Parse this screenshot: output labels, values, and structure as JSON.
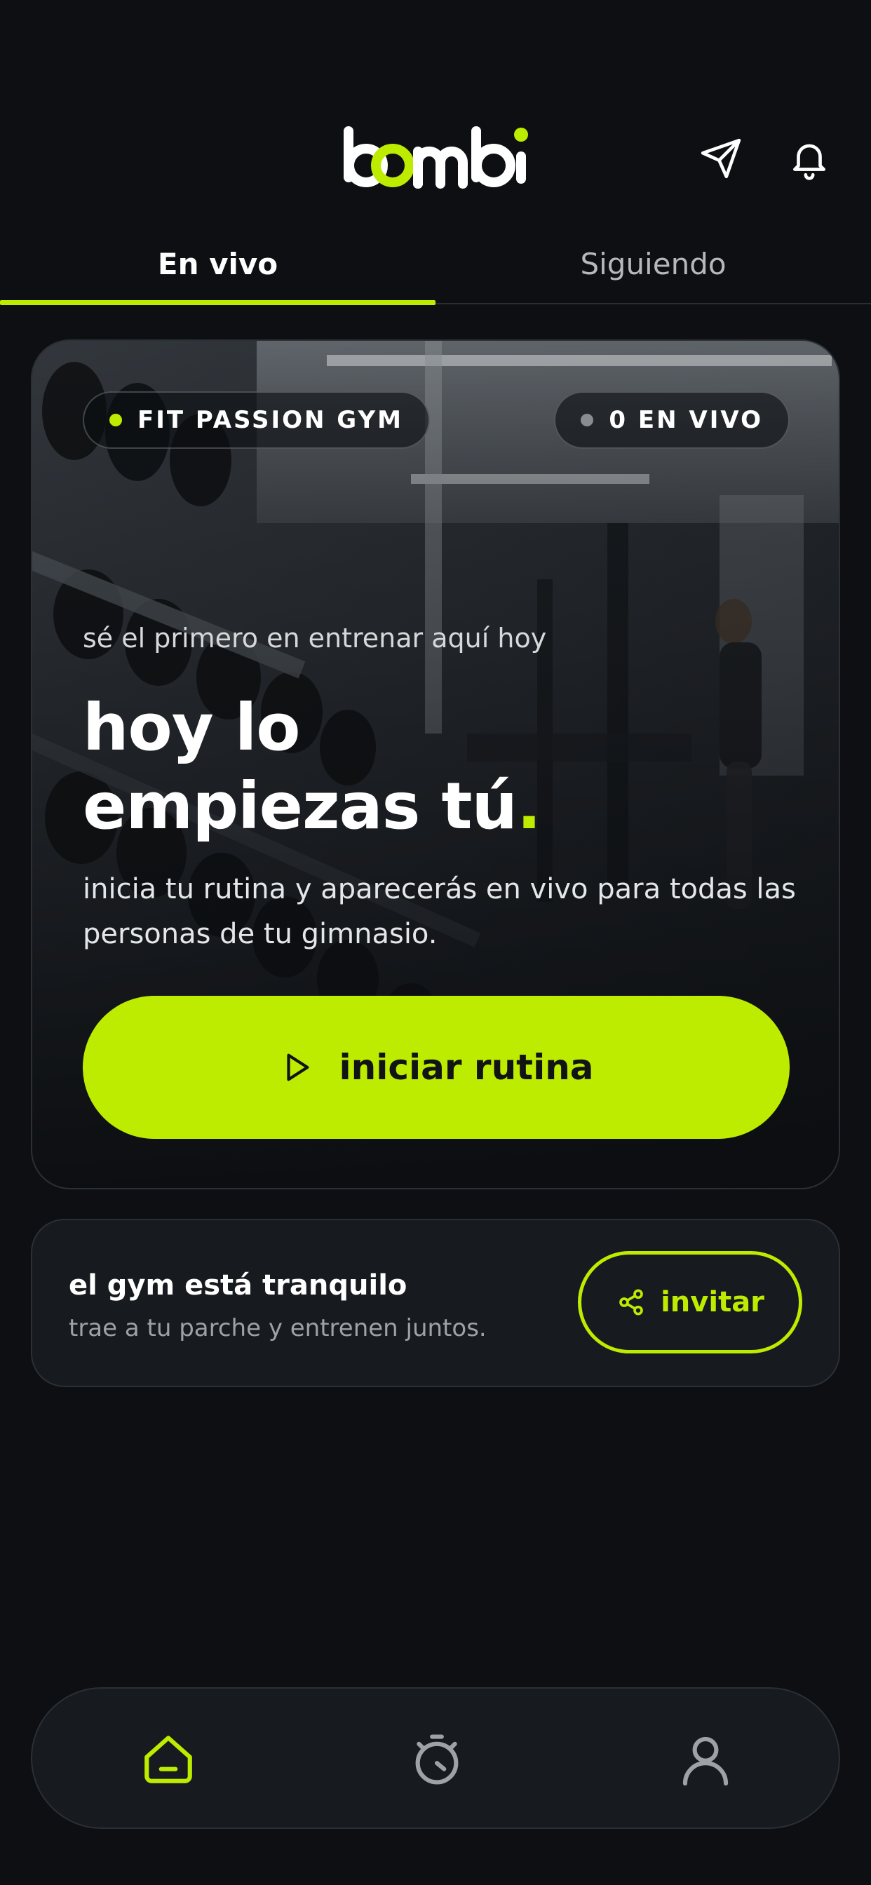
{
  "header": {
    "logo_text": "bombi",
    "send_icon": "send-icon",
    "bell_icon": "bell-icon"
  },
  "tabs": [
    {
      "label": "En vivo",
      "active": true
    },
    {
      "label": "Siguiendo",
      "active": false
    }
  ],
  "hero": {
    "gym_pill": "FIT PASSION GYM",
    "live_pill": "0 EN VIVO",
    "kicker": "sé el primero en entrenar aquí hoy",
    "title_line1": "hoy lo",
    "title_line2": "empiezas tú",
    "title_dot": ".",
    "description": "inicia tu rutina y aparecerás en vivo para todas las personas de tu gimnasio.",
    "start_label": "iniciar rutina"
  },
  "quiet_card": {
    "title": "el gym está tranquilo",
    "subtitle": "trae a tu parche y entrenen juntos.",
    "invite_label": "invitar"
  },
  "bottom_nav": [
    {
      "icon": "home-icon",
      "active": true
    },
    {
      "icon": "stopwatch-icon",
      "active": false
    },
    {
      "icon": "profile-icon",
      "active": false
    }
  ],
  "colors": {
    "accent": "#bdec00",
    "background": "#0d0f12",
    "card": "#171a1e"
  }
}
